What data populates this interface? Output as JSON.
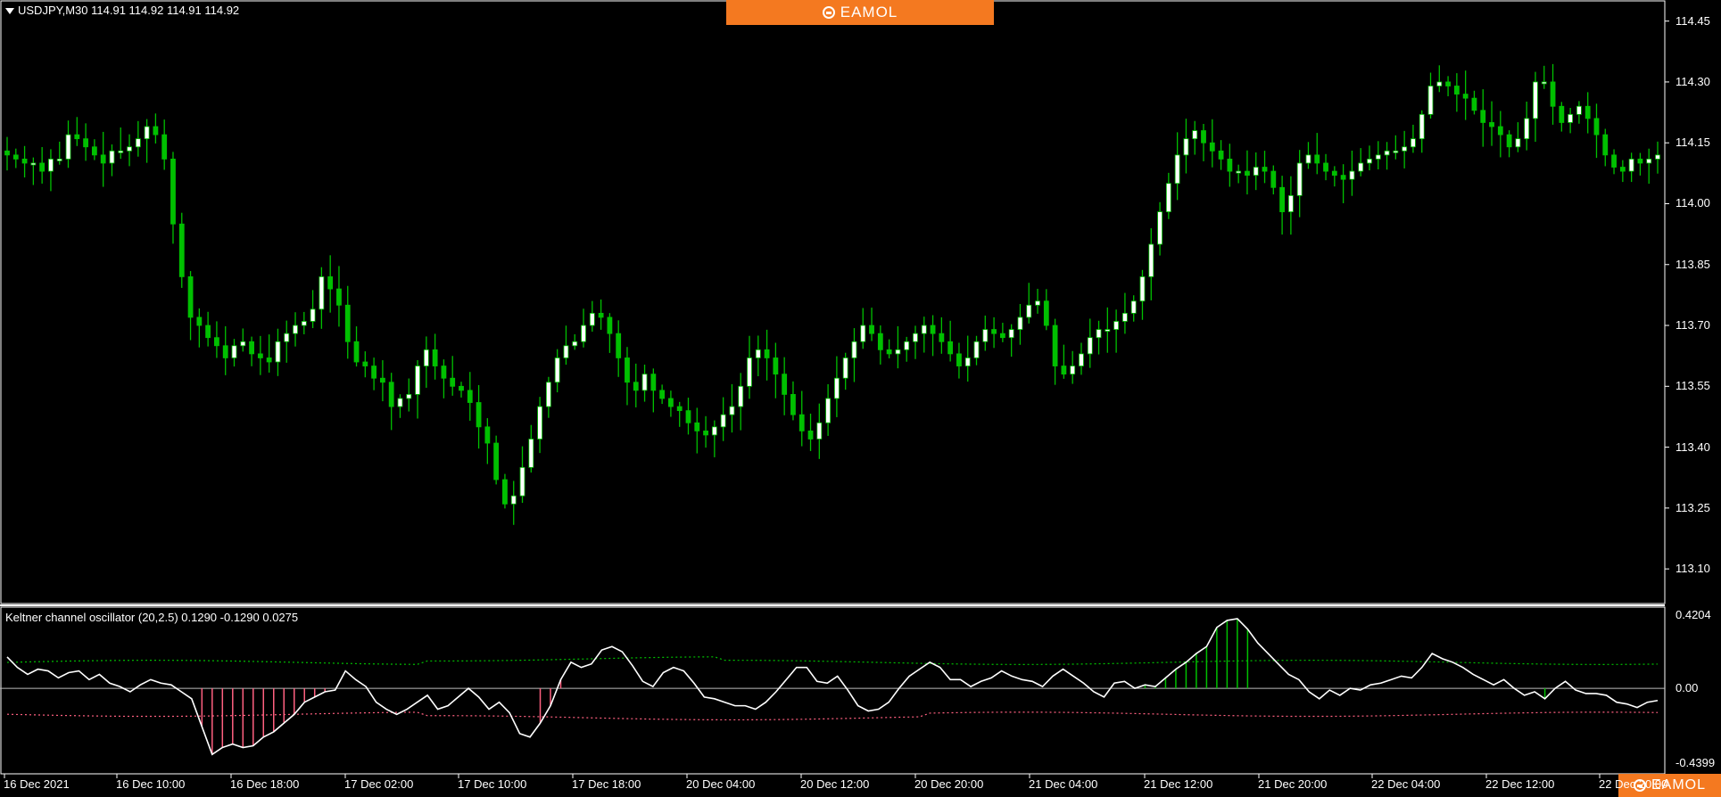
{
  "symbol_header": "USDJPY,M30  114.91 114.92 114.91 114.92",
  "oscillator_header": "Keltner channel oscillator (20,2.5) 0.1290 -0.1290 0.0275",
  "brand": {
    "name": "EAMOL",
    "color": "#f47920"
  },
  "price_axis": [
    "114.45",
    "114.30",
    "114.15",
    "114.00",
    "113.85",
    "113.70",
    "113.55",
    "113.40",
    "113.25",
    "113.10"
  ],
  "osc_axis": [
    "0.4204",
    "0.00",
    "-0.4399"
  ],
  "time_axis": [
    "16 Dec 2021",
    "16 Dec 10:00",
    "16 Dec 18:00",
    "17 Dec 02:00",
    "17 Dec 10:00",
    "17 Dec 18:00",
    "20 Dec 04:00",
    "20 Dec 12:00",
    "20 Dec 20:00",
    "21 Dec 04:00",
    "21 Dec 12:00",
    "21 Dec 20:00",
    "22 Dec 04:00",
    "22 Dec 12:00",
    "22 Dec 20:00"
  ],
  "colors": {
    "bull": "#ffffff",
    "bear": "#00c000",
    "line": "#ffffff",
    "upper": "#00c000",
    "lower": "#ff6080",
    "hist_pos": "#00c000",
    "hist_neg": "#ff6080"
  },
  "chart_data": [
    {
      "type": "candlestick",
      "title": "USDJPY,M30",
      "ylim": [
        113.03,
        114.48
      ],
      "close": [
        114.12,
        114.11,
        114.1,
        114.1,
        114.08,
        114.11,
        114.11,
        114.17,
        114.16,
        114.14,
        114.12,
        114.1,
        114.13,
        114.13,
        114.14,
        114.16,
        114.19,
        114.17,
        114.11,
        113.95,
        113.82,
        113.72,
        113.7,
        113.67,
        113.65,
        113.62,
        113.65,
        113.66,
        113.63,
        113.62,
        113.61,
        113.66,
        113.68,
        113.7,
        113.71,
        113.74,
        113.82,
        113.79,
        113.75,
        113.66,
        113.61,
        113.6,
        113.57,
        113.56,
        113.5,
        113.52,
        113.53,
        113.6,
        113.64,
        113.6,
        113.57,
        113.55,
        113.54,
        113.51,
        113.45,
        113.41,
        113.32,
        113.26,
        113.28,
        113.35,
        113.42,
        113.5,
        113.56,
        113.62,
        113.65,
        113.66,
        113.7,
        113.73,
        113.72,
        113.68,
        113.62,
        113.56,
        113.54,
        113.58,
        113.54,
        113.52,
        113.5,
        113.49,
        113.46,
        113.44,
        113.43,
        113.45,
        113.48,
        113.5,
        113.55,
        113.62,
        113.64,
        113.62,
        113.58,
        113.53,
        113.48,
        113.44,
        113.42,
        113.46,
        113.52,
        113.57,
        113.62,
        113.66,
        113.7,
        113.68,
        113.64,
        113.63,
        113.64,
        113.66,
        113.68,
        113.7,
        113.68,
        113.66,
        113.63,
        113.6,
        113.62,
        113.66,
        113.69,
        113.68,
        113.67,
        113.69,
        113.72,
        113.75,
        113.76,
        113.7,
        113.6,
        113.58,
        113.6,
        113.63,
        113.67,
        113.69,
        113.69,
        113.71,
        113.73,
        113.76,
        113.82,
        113.9,
        113.98,
        114.05,
        114.12,
        114.16,
        114.18,
        114.15,
        114.13,
        114.11,
        114.08,
        114.08,
        114.07,
        114.09,
        114.08,
        114.04,
        113.98,
        114.02,
        114.1,
        114.12,
        114.1,
        114.08,
        114.07,
        114.06,
        114.08,
        114.1,
        114.11,
        114.12,
        114.13,
        114.13,
        114.14,
        114.16,
        114.22,
        114.29,
        114.3,
        114.29,
        114.27,
        114.26,
        114.23,
        114.2,
        114.19,
        114.17,
        114.14,
        114.16,
        114.21,
        114.3,
        114.3,
        114.24,
        114.2,
        114.22,
        114.24,
        114.21,
        114.17,
        114.12,
        114.09,
        114.08,
        114.11,
        114.1,
        114.11,
        114.12
      ]
    },
    {
      "type": "line",
      "title": "Keltner channel oscillator (20,2.5)",
      "ylim": [
        -0.4399,
        0.4204
      ],
      "upper": 0.129,
      "lower": -0.129,
      "series": [
        {
          "name": "oscillator",
          "values": [
            0.18,
            0.12,
            0.08,
            0.11,
            0.1,
            0.06,
            0.09,
            0.1,
            0.05,
            0.08,
            0.03,
            0.01,
            -0.02,
            0.02,
            0.05,
            0.03,
            0.02,
            -0.02,
            -0.06,
            -0.22,
            -0.38,
            -0.34,
            -0.32,
            -0.34,
            -0.33,
            -0.28,
            -0.25,
            -0.2,
            -0.15,
            -0.08,
            -0.05,
            -0.02,
            -0.01,
            0.1,
            0.05,
            0.01,
            -0.08,
            -0.12,
            -0.15,
            -0.12,
            -0.08,
            -0.04,
            -0.12,
            -0.1,
            -0.05,
            0.0,
            -0.05,
            -0.12,
            -0.08,
            -0.14,
            -0.26,
            -0.28,
            -0.2,
            -0.1,
            0.05,
            0.15,
            0.12,
            0.14,
            0.22,
            0.24,
            0.21,
            0.13,
            0.04,
            0.01,
            0.09,
            0.12,
            0.1,
            0.03,
            -0.05,
            -0.06,
            -0.08,
            -0.1,
            -0.1,
            -0.12,
            -0.08,
            -0.02,
            0.05,
            0.12,
            0.12,
            0.04,
            0.03,
            0.07,
            -0.01,
            -0.1,
            -0.13,
            -0.12,
            -0.08,
            0.0,
            0.07,
            0.11,
            0.15,
            0.12,
            0.05,
            0.05,
            0.01,
            0.04,
            0.06,
            0.1,
            0.07,
            0.05,
            0.04,
            0.01,
            0.07,
            0.11,
            0.07,
            0.03,
            -0.02,
            -0.05,
            0.03,
            0.04,
            0.0,
            0.02,
            0.01,
            0.06,
            0.11,
            0.15,
            0.2,
            0.24,
            0.35,
            0.39,
            0.4,
            0.34,
            0.26,
            0.2,
            0.14,
            0.08,
            0.05,
            -0.02,
            -0.06,
            -0.01,
            -0.04,
            0.0,
            -0.01,
            0.02,
            0.03,
            0.05,
            0.07,
            0.06,
            0.12,
            0.2,
            0.17,
            0.15,
            0.12,
            0.08,
            0.05,
            0.02,
            0.05,
            0.0,
            -0.04,
            -0.02,
            -0.06,
            0.0,
            0.04,
            -0.01,
            -0.03,
            -0.03,
            -0.04,
            -0.08,
            -0.09,
            -0.11,
            -0.08,
            -0.07
          ]
        }
      ],
      "hist_pos_range": [
        110,
        121
      ],
      "hist_neg_ranges": [
        [
          19,
          31
        ],
        [
          52,
          54
        ]
      ],
      "hist_pos_extra": [
        150
      ]
    }
  ]
}
